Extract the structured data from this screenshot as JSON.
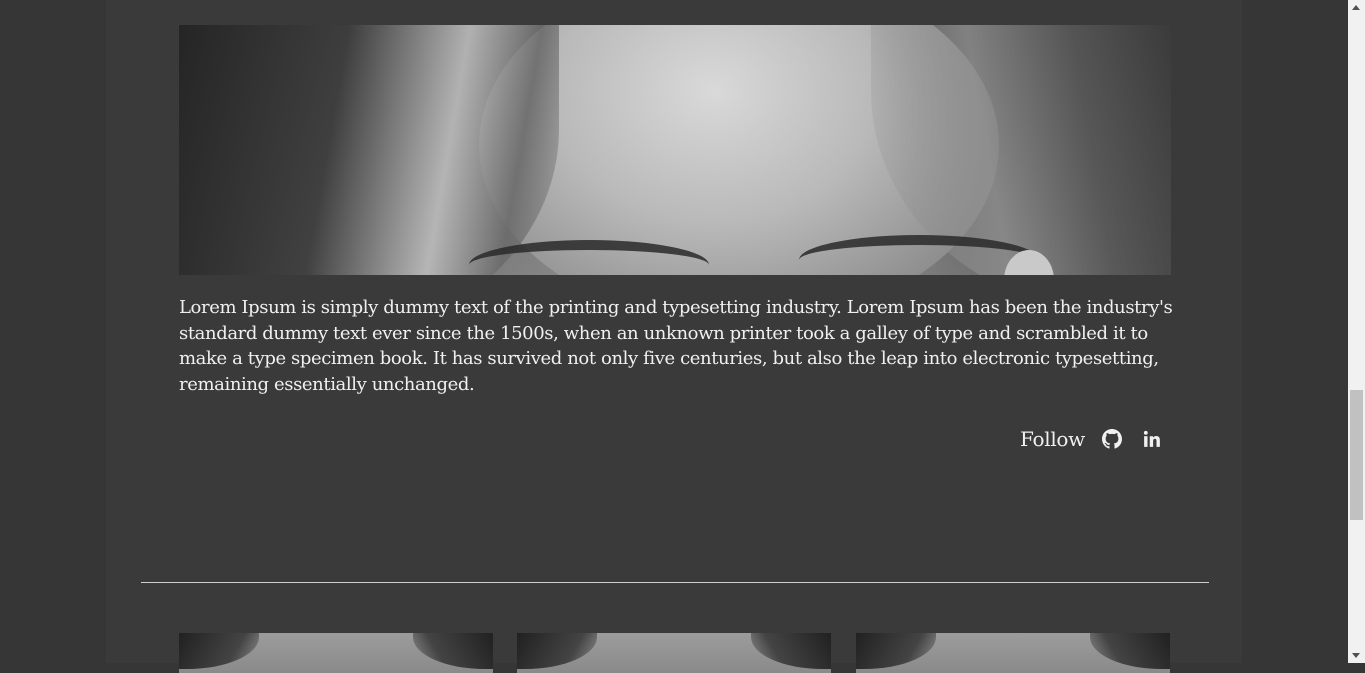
{
  "article": {
    "description": "Lorem Ipsum is simply dummy text of the printing and typesetting industry. Lorem Ipsum has been the industry's standard dummy text ever since the 1500s, when an unknown printer took a galley of type and scrambled it to make a type specimen book. It has survived not only five centuries, but also the leap into electronic typesetting, remaining essentially unchanged."
  },
  "follow": {
    "label": "Follow",
    "links": [
      {
        "icon": "github-icon"
      },
      {
        "icon": "linkedin-icon"
      }
    ]
  },
  "colors": {
    "background": "#363636",
    "panel": "#3a3a3a",
    "text": "#f0f0f0",
    "divider": "#cfcfcf"
  }
}
